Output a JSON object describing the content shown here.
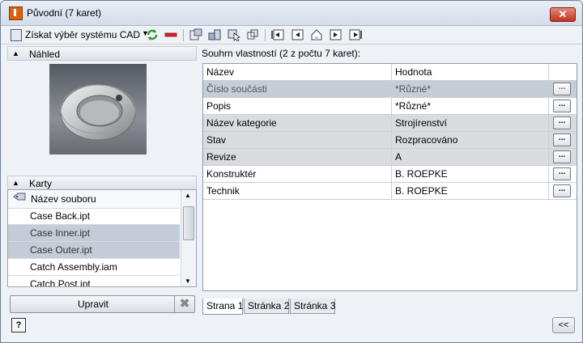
{
  "window": {
    "title": "Původní (7 karet)"
  },
  "toolbar": {
    "get_cad_label": "Získat výběr systému CAD"
  },
  "left": {
    "preview_label": "Náhled",
    "cards_label": "Karty",
    "list_header": "Název souboru",
    "files": [
      {
        "name": "Case Back.ipt",
        "selected": false
      },
      {
        "name": "Case Inner.ipt",
        "selected": true
      },
      {
        "name": "Case Outer.ipt",
        "selected": true
      },
      {
        "name": "Catch Assembly.iam",
        "selected": false
      },
      {
        "name": "Catch Post.ipt",
        "selected": false
      }
    ],
    "edit_button": "Upravit"
  },
  "right": {
    "summary": "Souhrn vlastností (2 z počtu 7 karet):",
    "columns": [
      "Název",
      "Hodnota"
    ],
    "rows": [
      {
        "name": "Číslo součásti",
        "value": "*Různé*"
      },
      {
        "name": "Popis",
        "value": "*Různé*"
      },
      {
        "name": "Název kategorie",
        "value": "Strojírenství"
      },
      {
        "name": "Stav",
        "value": "Rozpracováno"
      },
      {
        "name": "Revize",
        "value": "A"
      },
      {
        "name": "Konstruktér",
        "value": "B. ROEPKE"
      },
      {
        "name": "Technik",
        "value": "B. ROEPKE"
      }
    ],
    "ellipsis": "...",
    "tabs": [
      "Strana 1",
      "Stránka 2",
      "Stránka 3"
    ]
  },
  "footer": {
    "help": "?",
    "collapse": "<<"
  },
  "colors": {
    "close": "#c2331f",
    "selection": "#c4ccd7",
    "app_icon": "#d9620f"
  }
}
